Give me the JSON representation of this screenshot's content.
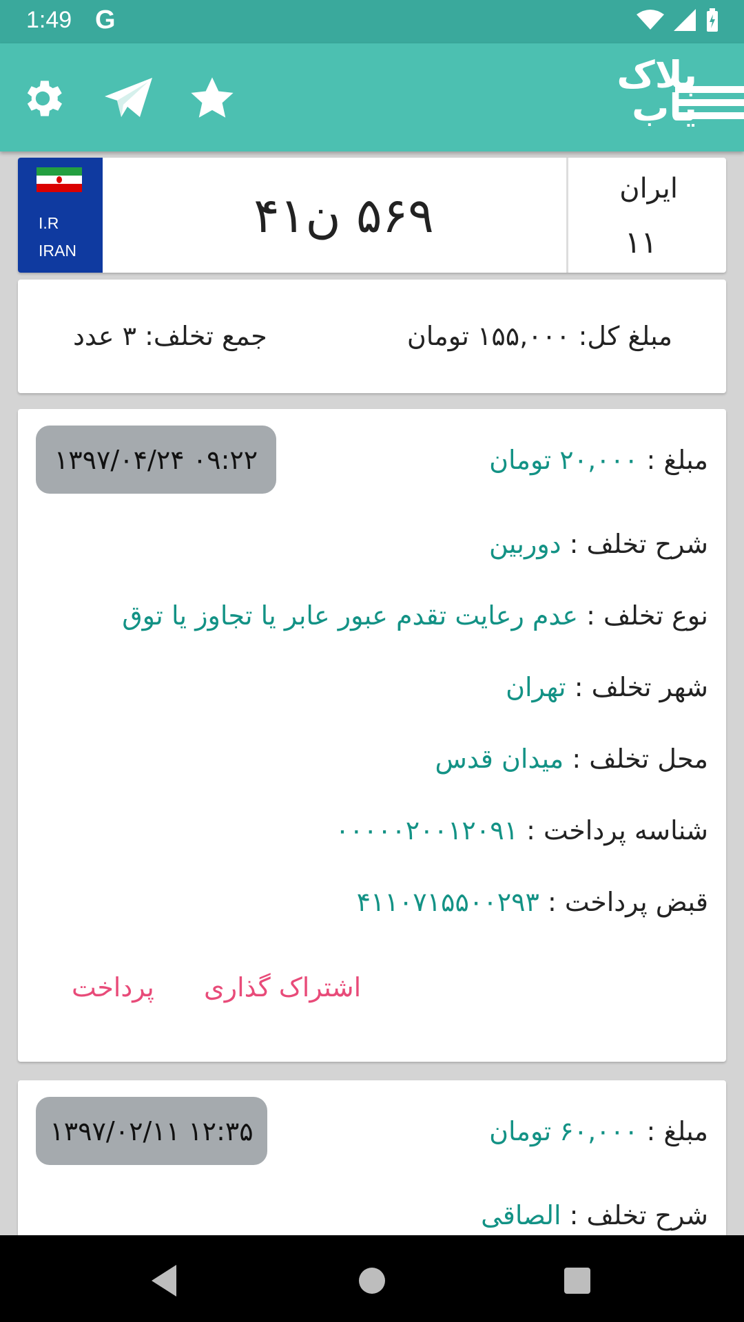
{
  "status_bar": {
    "time": "1:49",
    "g": "G"
  },
  "app": {
    "logo_line1": "پلاک",
    "logo_line2": "یاب",
    "icons": [
      "gear-icon",
      "telegram-icon",
      "star-icon"
    ]
  },
  "plate": {
    "ir": "I.R",
    "iran": "IRAN",
    "number": "۵۶۹ ن۴۱",
    "region_label": "ایران",
    "region_code": "۱۱"
  },
  "summary": {
    "total_amount": "مبلغ کل: ۱۵۵,۰۰۰ تومان",
    "total_count": "جمع تخلف: ۳ عدد"
  },
  "violations": [
    {
      "datetime": "۱۳۹۷/۰۴/۲۴   ۰۹:۲۲",
      "amount_label": "مبلغ : ",
      "amount": "۲۰,۰۰۰ تومان",
      "desc_label": "شرح تخلف : ",
      "desc": "دوربین",
      "type_label": "نوع تخلف : ",
      "type": "عدم رعایت تقدم عبور عابر یا تجاوز یا توق",
      "city_label": "شهر تخلف : ",
      "city": "تهران",
      "place_label": "محل تخلف : ",
      "place": "میدان قدس",
      "pay_id_label": "شناسه پرداخت : ",
      "pay_id": "۰۰۰۰۰۲۰۰۱۲۰۹۱",
      "receipt_label": "قبض پرداخت : ",
      "receipt": "۴۱۱۰۷۱۵۵۰۰۲۹۳",
      "share_label": "اشتراک گذاری",
      "pay_label": "پرداخت"
    },
    {
      "datetime": "۱۳۹۷/۰۲/۱۱   ۱۲:۳۵",
      "amount_label": "مبلغ : ",
      "amount": "۶۰,۰۰۰ تومان",
      "desc_label": "شرح تخلف : ",
      "desc": "الصاقی"
    }
  ],
  "colors": {
    "primary": "#4cc0b1",
    "status": "#3aa99c",
    "value": "#139285",
    "action": "#e84b79",
    "plate_blue": "#0f3aa0"
  }
}
